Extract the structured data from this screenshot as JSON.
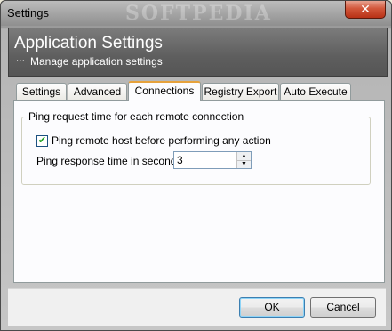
{
  "window": {
    "title": "Settings",
    "close_symbol": "✕"
  },
  "watermark": "SOFTPEDIA",
  "header": {
    "title": "Application Settings",
    "subtitle": "Manage application settings",
    "dots": "⋯"
  },
  "tabs": [
    {
      "label": "Settings"
    },
    {
      "label": "Advanced"
    },
    {
      "label": "Connections"
    },
    {
      "label": "Registry Export"
    },
    {
      "label": "Auto Execute"
    }
  ],
  "active_tab": "Connections",
  "group": {
    "label": "Ping request time for each remote connection",
    "checkbox_label": "Ping remote host before performing any action",
    "checkbox_checked": true,
    "check_mark": "✔",
    "response_label": "Ping response time in seconds:",
    "response_value": "3",
    "spin_up": "▲",
    "spin_down": "▼"
  },
  "footer": {
    "ok_label": "OK",
    "cancel_label": "Cancel"
  },
  "colors": {
    "header_bg": "#5e5e5e",
    "active_tab_accent": "#e6a23c",
    "close_button": "#d2573b"
  },
  "icons": {
    "close": "close-icon",
    "spin_up": "arrow-up-icon",
    "spin_down": "arrow-down-icon",
    "check": "check-icon"
  }
}
